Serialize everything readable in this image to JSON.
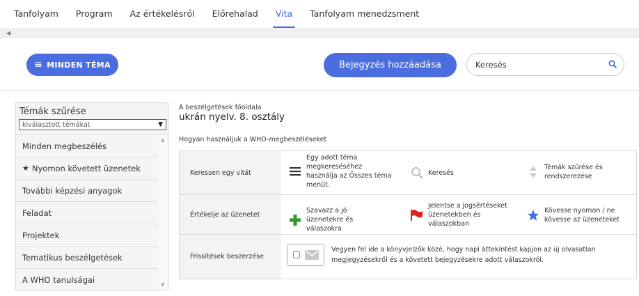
{
  "tabs": [
    {
      "label": "Tanfolyam"
    },
    {
      "label": "Program"
    },
    {
      "label": "Az értékelésről"
    },
    {
      "label": "Előrehalad"
    },
    {
      "label": "Vita",
      "active": true
    },
    {
      "label": "Tanfolyam menedzsment"
    }
  ],
  "toolbar": {
    "all_topics_label": "MINDEN TÉMA",
    "add_post_label": "Bejegyzés hozzáadása",
    "search_placeholder": "Keresés"
  },
  "sidebar": {
    "title": "Témák szűrése",
    "select_value": "kiválasztott témákat",
    "items": [
      {
        "label": "Minden megbeszélés"
      },
      {
        "label": "Nyomon követett üzenetek",
        "icon": "star-icon"
      },
      {
        "label": "További képzési anyagok"
      },
      {
        "label": "Feladat"
      },
      {
        "label": "Projektek"
      },
      {
        "label": "Tematikus beszélgetések"
      },
      {
        "label": "A WHO tanulságai"
      }
    ]
  },
  "main": {
    "breadcrumb": "A beszélgetések főoldala",
    "title": "ukrán nyelv. 8. osztály",
    "howto_title": "Hogyan használjuk a WHO-megbeszéléseket",
    "rows": [
      {
        "label": "Keressen egy vitát",
        "cells": [
          {
            "icon": "menu-icon",
            "text": "Egy adott téma megkereséséhez használja az Összes téma menüt."
          },
          {
            "icon": "search-icon",
            "text": "Keresés"
          },
          {
            "icon": "sort-icon",
            "text": "Témák szűrése és rendszerezése"
          }
        ]
      },
      {
        "label": "Értékelje az üzenetet",
        "cells": [
          {
            "icon": "plus-icon",
            "text": "Szavazz a jó üzenetekre és válaszokra"
          },
          {
            "icon": "flag-icon",
            "text": "Jelentse a jogsértéseket üzenetekben és válaszokban"
          },
          {
            "icon": "star-icon",
            "text": "Kövesse nyomon / ne kövesse az üzeneteket"
          }
        ]
      },
      {
        "label": "Frissítések beszerzése",
        "text": "Vegyen fel ide a könyvjelzők közé, hogy napi áttekintést kapjon az új olvasatlan megjegyzésekről és a követett bejegyzésekre adott válaszokról."
      }
    ]
  },
  "colors": {
    "accent": "#4a6ee0",
    "plus": "#2e9a2e",
    "flag": "#e02020",
    "star_blue": "#4a6ee0"
  }
}
